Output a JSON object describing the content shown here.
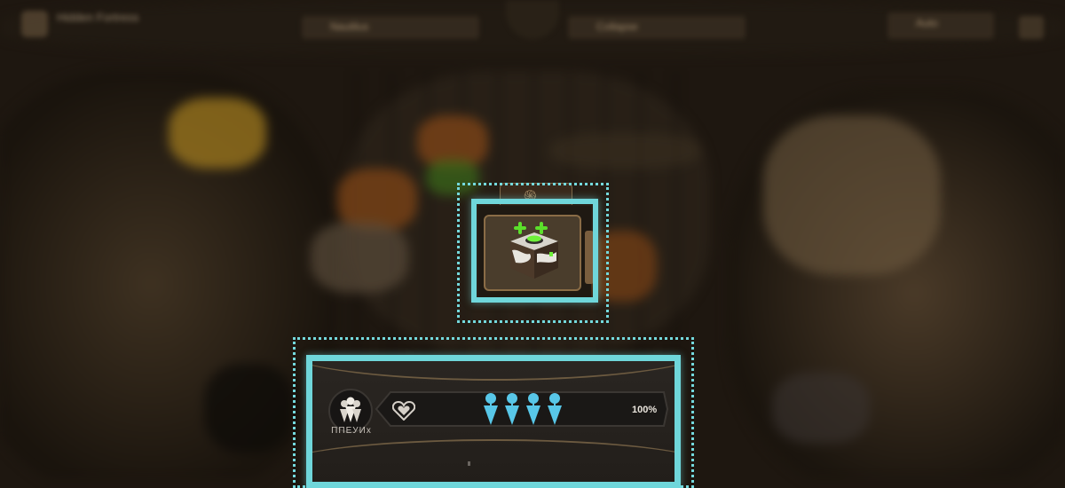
{
  "hud": {
    "title": "Hidden Fortress",
    "resource_1": "Nautilus",
    "resource_2": "Collapse",
    "resource_3": "Auto"
  },
  "colors": {
    "highlight": "#6fd6da",
    "heal_plus": "#5be02b",
    "pin_blue": "#58c7e8"
  },
  "grid_tile": {
    "icon": "mystery-cube-icon",
    "rune": "spiral-rune-icon"
  },
  "status_panel": {
    "emblem_icon": "squad-emblem-icon",
    "emblem_label": "ΠΠΕУИх",
    "heart_icon": "heart-icon",
    "unit_pins": 4,
    "percent": "100%"
  }
}
